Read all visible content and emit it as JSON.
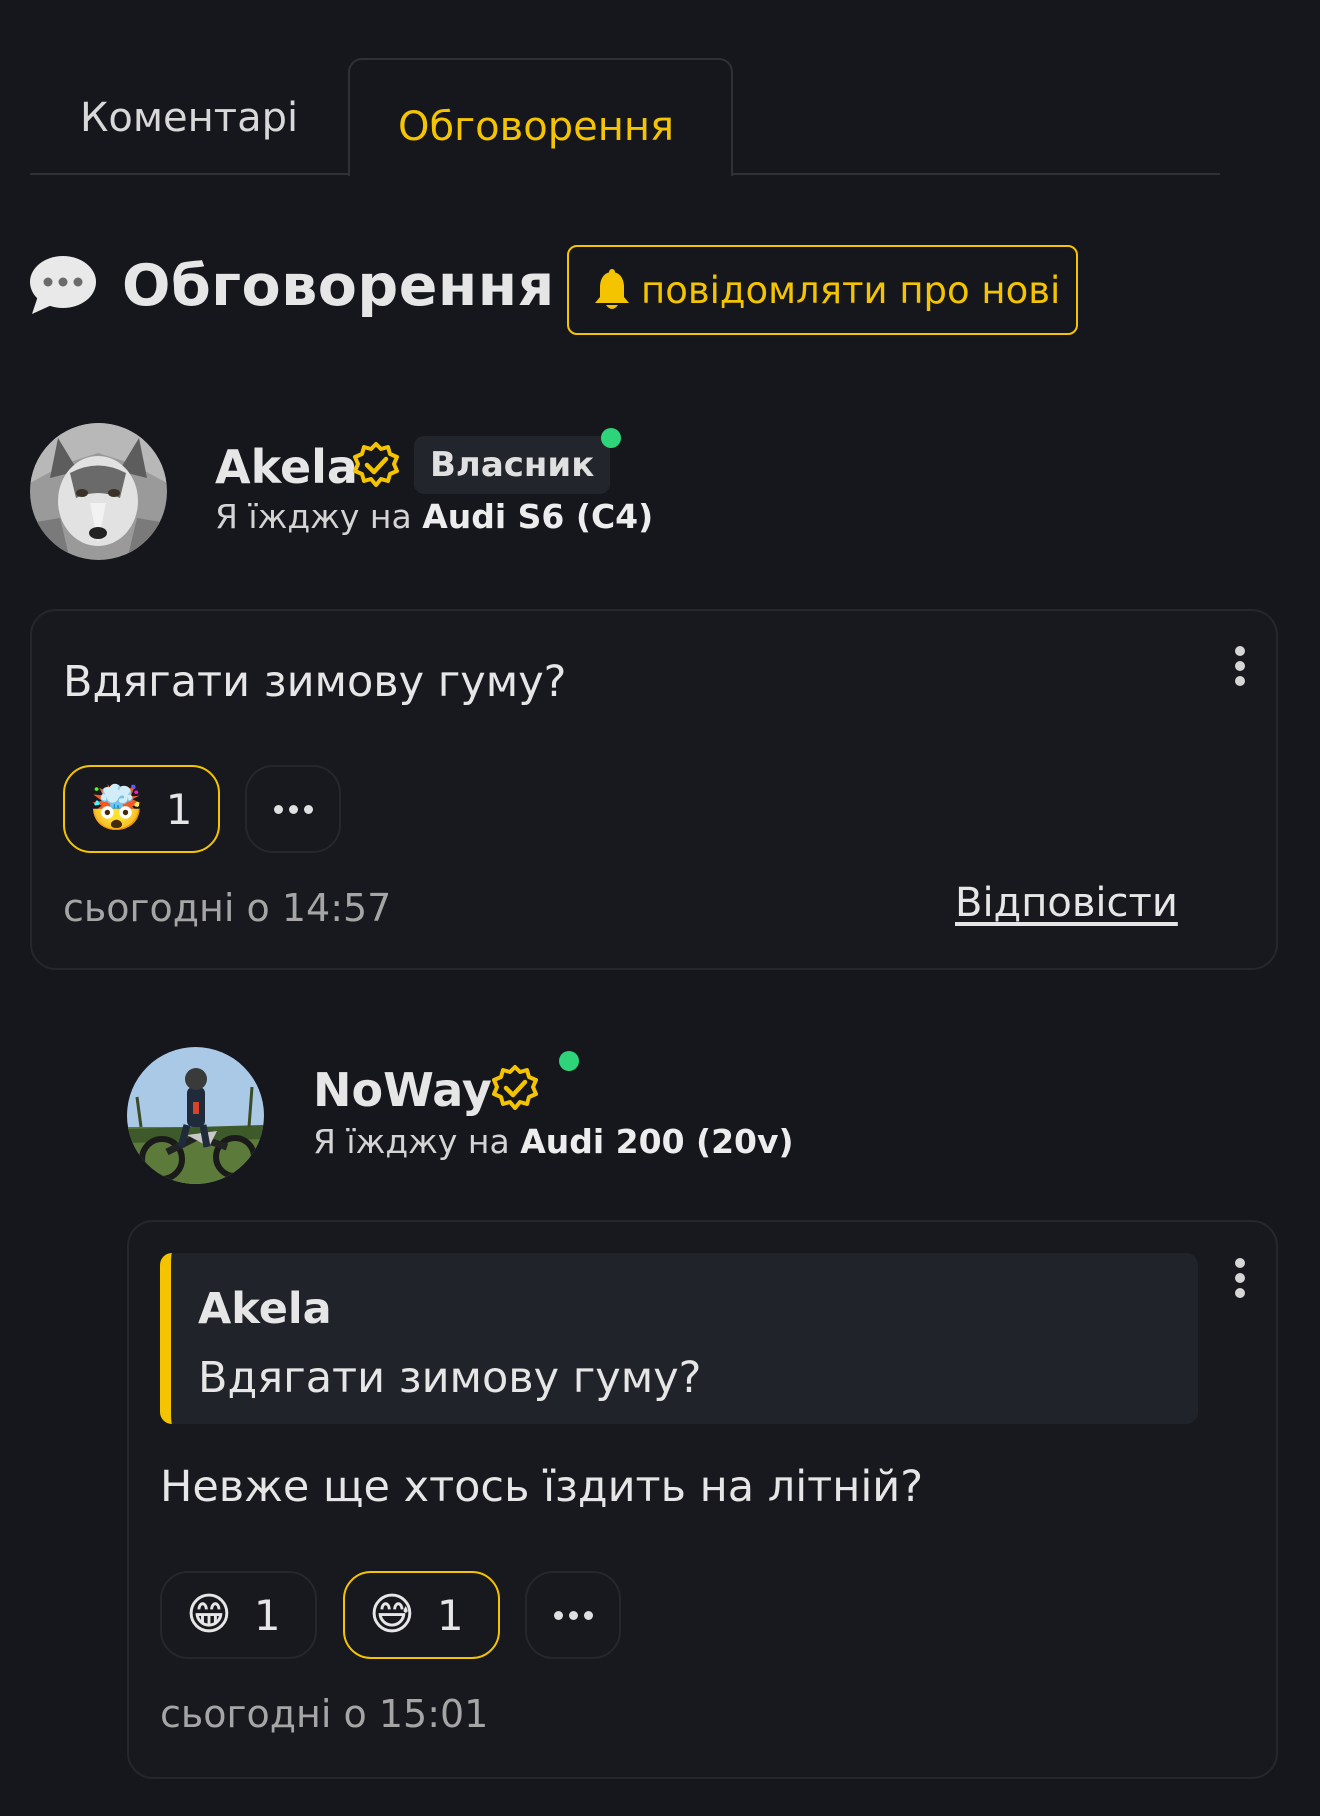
{
  "tabs": [
    {
      "label": "Коментарі",
      "active": false
    },
    {
      "label": "Обговорення",
      "active": true
    }
  ],
  "section": {
    "title": "Обговорення",
    "icon": "speech-bubble-icon",
    "notify_label": "повідомляти про нові",
    "notify_icon": "bell-icon"
  },
  "accent_color": "#f5c400",
  "posts": [
    {
      "author": "Akela",
      "verified": true,
      "role": "Власник",
      "online": true,
      "drives_prefix": "Я їжджу на",
      "car": "Audi S6 (C4)",
      "text": "Вдягати зимову гуму?",
      "reactions": [
        {
          "emoji": "🤯",
          "count": "1",
          "active": true
        }
      ],
      "time": "сьогодні о 14:57",
      "reply_label": "Відповісти"
    },
    {
      "author": "NoWay",
      "verified": true,
      "online": true,
      "drives_prefix": "Я їжджу на",
      "car": "Audi 200 (20v)",
      "quote": {
        "author": "Akela",
        "text": "Вдягати зимову гуму?"
      },
      "text": "Невже ще хтось їздить на літній?",
      "reactions": [
        {
          "emoji": "😁",
          "count": "1",
          "active": false
        },
        {
          "emoji": "😅",
          "count": "1",
          "active": true
        }
      ],
      "time": "сьогодні о 15:01"
    }
  ]
}
